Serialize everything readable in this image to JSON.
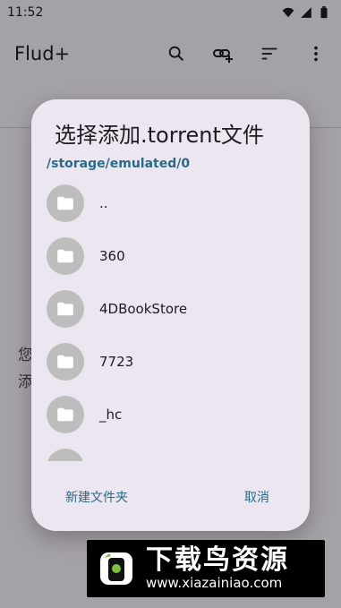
{
  "status_bar": {
    "time": "11:52"
  },
  "app": {
    "title": "Flud+",
    "actions": [
      "search-icon",
      "add-link-icon",
      "sort-icon",
      "more-vert-icon"
    ],
    "tabs": [
      "",
      "",
      ""
    ],
    "empty_message": "您\n添"
  },
  "dialog": {
    "title": "选择添加.torrent文件",
    "path": "/storage/emulated/0",
    "items": [
      {
        "label": ".."
      },
      {
        "label": "360"
      },
      {
        "label": "4DBookStore"
      },
      {
        "label": "7723"
      },
      {
        "label": "_hc"
      }
    ],
    "actions": {
      "new_folder": "新建文件夹",
      "cancel": "取消"
    }
  },
  "watermark": {
    "title": "下载鸟资源",
    "url": "www.xiazainiao.com"
  },
  "colors": {
    "accent": "#2a6a87",
    "dialog_bg": "#ece6f0",
    "folder_bg": "#bdbdbd"
  }
}
